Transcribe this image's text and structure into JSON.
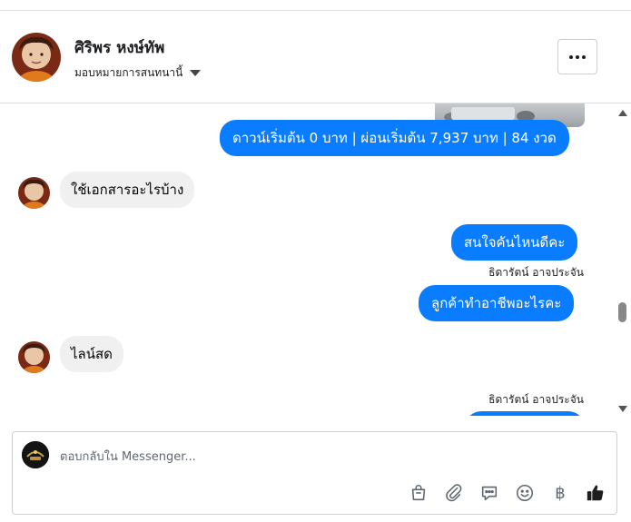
{
  "header": {
    "contact_name": "ศิริพร หงษ์ทัพ",
    "assign_label": "มอบหมายการสนทนานี้",
    "more_button_label": "•••"
  },
  "thread": {
    "attachment_kind": "photo",
    "messages": [
      {
        "direction": "outgoing",
        "text": "ดาวน์เริ่มต้น 0 บาท | ผ่อนเริ่มต้น 7,937 บาท | 84 งวด"
      },
      {
        "direction": "incoming",
        "text": "ใช้เอกสารอะไรบ้าง"
      },
      {
        "direction": "outgoing",
        "text": "สนใจคันไหนดีคะ"
      },
      {
        "direction": "outgoing",
        "sender": "ธิดารัตน์ อาจประจัน",
        "text": "ลูกค้าทำอาชีพอะไรคะ"
      },
      {
        "direction": "incoming",
        "text": "ไลน์สด"
      },
      {
        "direction": "outgoing",
        "sender": "ธิดารัตน์ อาจประจัน",
        "text": ""
      }
    ]
  },
  "composer": {
    "placeholder": "ตอบกลับใน Messenger...",
    "tools": [
      "bag-icon",
      "paperclip-icon",
      "chat-bubble-icon",
      "smiley-icon",
      "baht-icon",
      "thumbs-up-icon"
    ],
    "baht_symbol": "฿"
  },
  "colors": {
    "outgoing_bubble": "#0a7cff",
    "incoming_bubble": "#f0f0f0",
    "like_icon": "#1c1e21"
  }
}
